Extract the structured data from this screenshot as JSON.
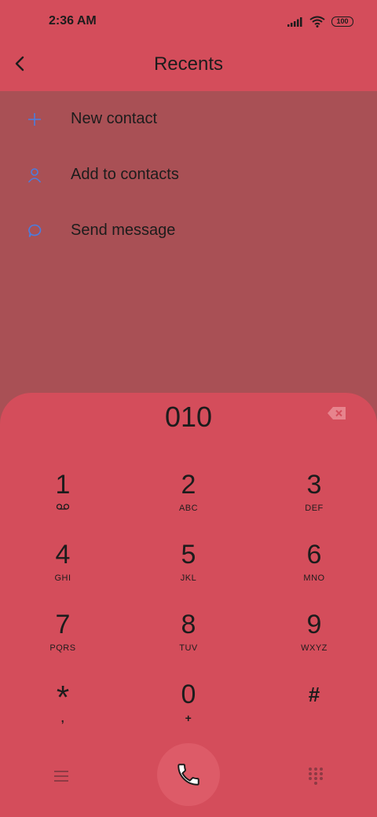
{
  "status": {
    "time": "2:36 AM",
    "battery": "100"
  },
  "header": {
    "title": "Recents"
  },
  "menu": [
    {
      "label": "New contact",
      "icon": "plus-icon"
    },
    {
      "label": "Add to contacts",
      "icon": "person-icon"
    },
    {
      "label": "Send message",
      "icon": "message-icon"
    }
  ],
  "dialpad": {
    "number": "010",
    "keys": [
      {
        "digit": "1",
        "letters": ""
      },
      {
        "digit": "2",
        "letters": "ABC"
      },
      {
        "digit": "3",
        "letters": "DEF"
      },
      {
        "digit": "4",
        "letters": "GHI"
      },
      {
        "digit": "5",
        "letters": "JKL"
      },
      {
        "digit": "6",
        "letters": "MNO"
      },
      {
        "digit": "7",
        "letters": "PQRS"
      },
      {
        "digit": "8",
        "letters": "TUV"
      },
      {
        "digit": "9",
        "letters": "WXYZ"
      },
      {
        "digit": "*",
        "letters": ","
      },
      {
        "digit": "0",
        "letters": "+"
      },
      {
        "digit": "#",
        "letters": ""
      }
    ]
  },
  "colors": {
    "accent": "#4a7de0",
    "background": "#d44d5b",
    "dim": "#a95055"
  }
}
